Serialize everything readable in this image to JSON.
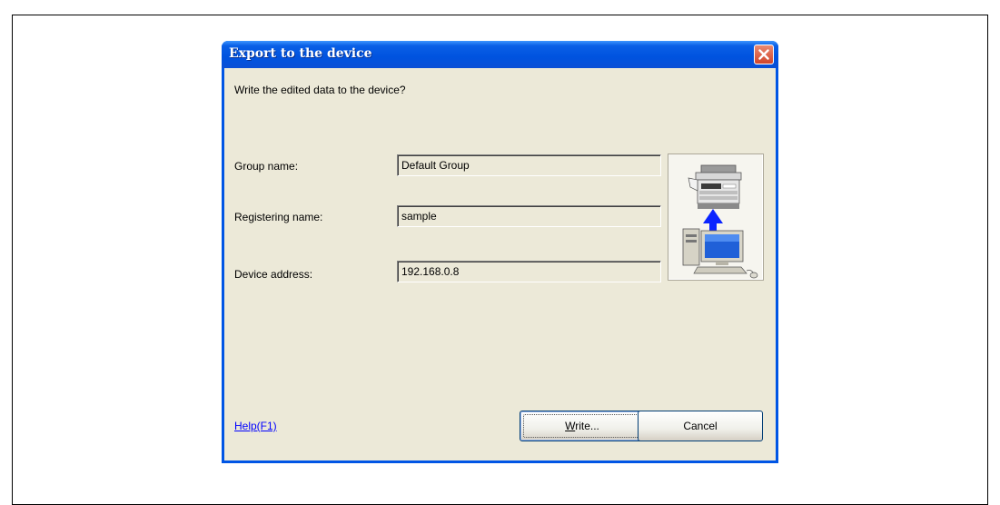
{
  "dialog": {
    "title": "Export to the device",
    "prompt": "Write the edited data to the device?",
    "fields": [
      {
        "label": "Group name:",
        "value": "Default Group"
      },
      {
        "label": "Registering name:",
        "value": "sample"
      },
      {
        "label": "Device address:",
        "value": "192.168.0.8"
      }
    ],
    "help_link": "Help(F1)",
    "buttons": {
      "write_label": "Write...",
      "write_mnemonic": "W",
      "write_rest": "rite...",
      "cancel_label": "Cancel"
    }
  },
  "icons": [
    "close-icon",
    "copier-icon",
    "upload-arrow-icon",
    "computer-icon"
  ],
  "colors": {
    "titlebar": "#0054e3",
    "client_bg": "#ece9d8",
    "close_button": "#d8492e",
    "link": "#0000ff",
    "arrow": "#0020ff"
  }
}
